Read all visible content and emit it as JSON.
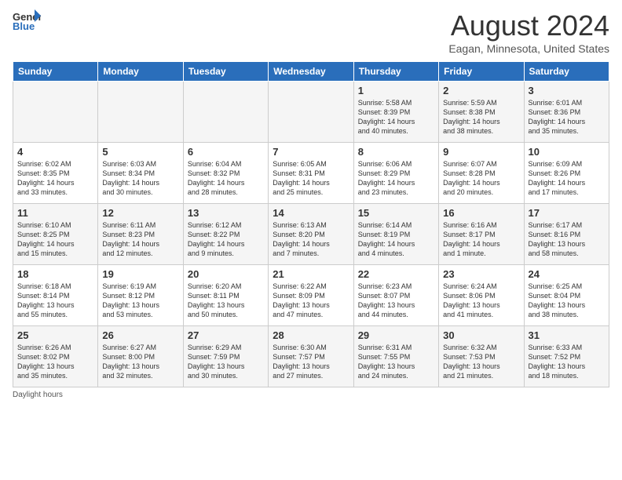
{
  "header": {
    "logo_general": "General",
    "logo_blue": "Blue",
    "month_title": "August 2024",
    "location": "Eagan, Minnesota, United States"
  },
  "days_of_week": [
    "Sunday",
    "Monday",
    "Tuesday",
    "Wednesday",
    "Thursday",
    "Friday",
    "Saturday"
  ],
  "weeks": [
    [
      {
        "day": "",
        "info": ""
      },
      {
        "day": "",
        "info": ""
      },
      {
        "day": "",
        "info": ""
      },
      {
        "day": "",
        "info": ""
      },
      {
        "day": "1",
        "info": "Sunrise: 5:58 AM\nSunset: 8:39 PM\nDaylight: 14 hours\nand 40 minutes."
      },
      {
        "day": "2",
        "info": "Sunrise: 5:59 AM\nSunset: 8:38 PM\nDaylight: 14 hours\nand 38 minutes."
      },
      {
        "day": "3",
        "info": "Sunrise: 6:01 AM\nSunset: 8:36 PM\nDaylight: 14 hours\nand 35 minutes."
      }
    ],
    [
      {
        "day": "4",
        "info": "Sunrise: 6:02 AM\nSunset: 8:35 PM\nDaylight: 14 hours\nand 33 minutes."
      },
      {
        "day": "5",
        "info": "Sunrise: 6:03 AM\nSunset: 8:34 PM\nDaylight: 14 hours\nand 30 minutes."
      },
      {
        "day": "6",
        "info": "Sunrise: 6:04 AM\nSunset: 8:32 PM\nDaylight: 14 hours\nand 28 minutes."
      },
      {
        "day": "7",
        "info": "Sunrise: 6:05 AM\nSunset: 8:31 PM\nDaylight: 14 hours\nand 25 minutes."
      },
      {
        "day": "8",
        "info": "Sunrise: 6:06 AM\nSunset: 8:29 PM\nDaylight: 14 hours\nand 23 minutes."
      },
      {
        "day": "9",
        "info": "Sunrise: 6:07 AM\nSunset: 8:28 PM\nDaylight: 14 hours\nand 20 minutes."
      },
      {
        "day": "10",
        "info": "Sunrise: 6:09 AM\nSunset: 8:26 PM\nDaylight: 14 hours\nand 17 minutes."
      }
    ],
    [
      {
        "day": "11",
        "info": "Sunrise: 6:10 AM\nSunset: 8:25 PM\nDaylight: 14 hours\nand 15 minutes."
      },
      {
        "day": "12",
        "info": "Sunrise: 6:11 AM\nSunset: 8:23 PM\nDaylight: 14 hours\nand 12 minutes."
      },
      {
        "day": "13",
        "info": "Sunrise: 6:12 AM\nSunset: 8:22 PM\nDaylight: 14 hours\nand 9 minutes."
      },
      {
        "day": "14",
        "info": "Sunrise: 6:13 AM\nSunset: 8:20 PM\nDaylight: 14 hours\nand 7 minutes."
      },
      {
        "day": "15",
        "info": "Sunrise: 6:14 AM\nSunset: 8:19 PM\nDaylight: 14 hours\nand 4 minutes."
      },
      {
        "day": "16",
        "info": "Sunrise: 6:16 AM\nSunset: 8:17 PM\nDaylight: 14 hours\nand 1 minute."
      },
      {
        "day": "17",
        "info": "Sunrise: 6:17 AM\nSunset: 8:16 PM\nDaylight: 13 hours\nand 58 minutes."
      }
    ],
    [
      {
        "day": "18",
        "info": "Sunrise: 6:18 AM\nSunset: 8:14 PM\nDaylight: 13 hours\nand 55 minutes."
      },
      {
        "day": "19",
        "info": "Sunrise: 6:19 AM\nSunset: 8:12 PM\nDaylight: 13 hours\nand 53 minutes."
      },
      {
        "day": "20",
        "info": "Sunrise: 6:20 AM\nSunset: 8:11 PM\nDaylight: 13 hours\nand 50 minutes."
      },
      {
        "day": "21",
        "info": "Sunrise: 6:22 AM\nSunset: 8:09 PM\nDaylight: 13 hours\nand 47 minutes."
      },
      {
        "day": "22",
        "info": "Sunrise: 6:23 AM\nSunset: 8:07 PM\nDaylight: 13 hours\nand 44 minutes."
      },
      {
        "day": "23",
        "info": "Sunrise: 6:24 AM\nSunset: 8:06 PM\nDaylight: 13 hours\nand 41 minutes."
      },
      {
        "day": "24",
        "info": "Sunrise: 6:25 AM\nSunset: 8:04 PM\nDaylight: 13 hours\nand 38 minutes."
      }
    ],
    [
      {
        "day": "25",
        "info": "Sunrise: 6:26 AM\nSunset: 8:02 PM\nDaylight: 13 hours\nand 35 minutes."
      },
      {
        "day": "26",
        "info": "Sunrise: 6:27 AM\nSunset: 8:00 PM\nDaylight: 13 hours\nand 32 minutes."
      },
      {
        "day": "27",
        "info": "Sunrise: 6:29 AM\nSunset: 7:59 PM\nDaylight: 13 hours\nand 30 minutes."
      },
      {
        "day": "28",
        "info": "Sunrise: 6:30 AM\nSunset: 7:57 PM\nDaylight: 13 hours\nand 27 minutes."
      },
      {
        "day": "29",
        "info": "Sunrise: 6:31 AM\nSunset: 7:55 PM\nDaylight: 13 hours\nand 24 minutes."
      },
      {
        "day": "30",
        "info": "Sunrise: 6:32 AM\nSunset: 7:53 PM\nDaylight: 13 hours\nand 21 minutes."
      },
      {
        "day": "31",
        "info": "Sunrise: 6:33 AM\nSunset: 7:52 PM\nDaylight: 13 hours\nand 18 minutes."
      }
    ]
  ],
  "footer": {
    "note": "Daylight hours"
  }
}
